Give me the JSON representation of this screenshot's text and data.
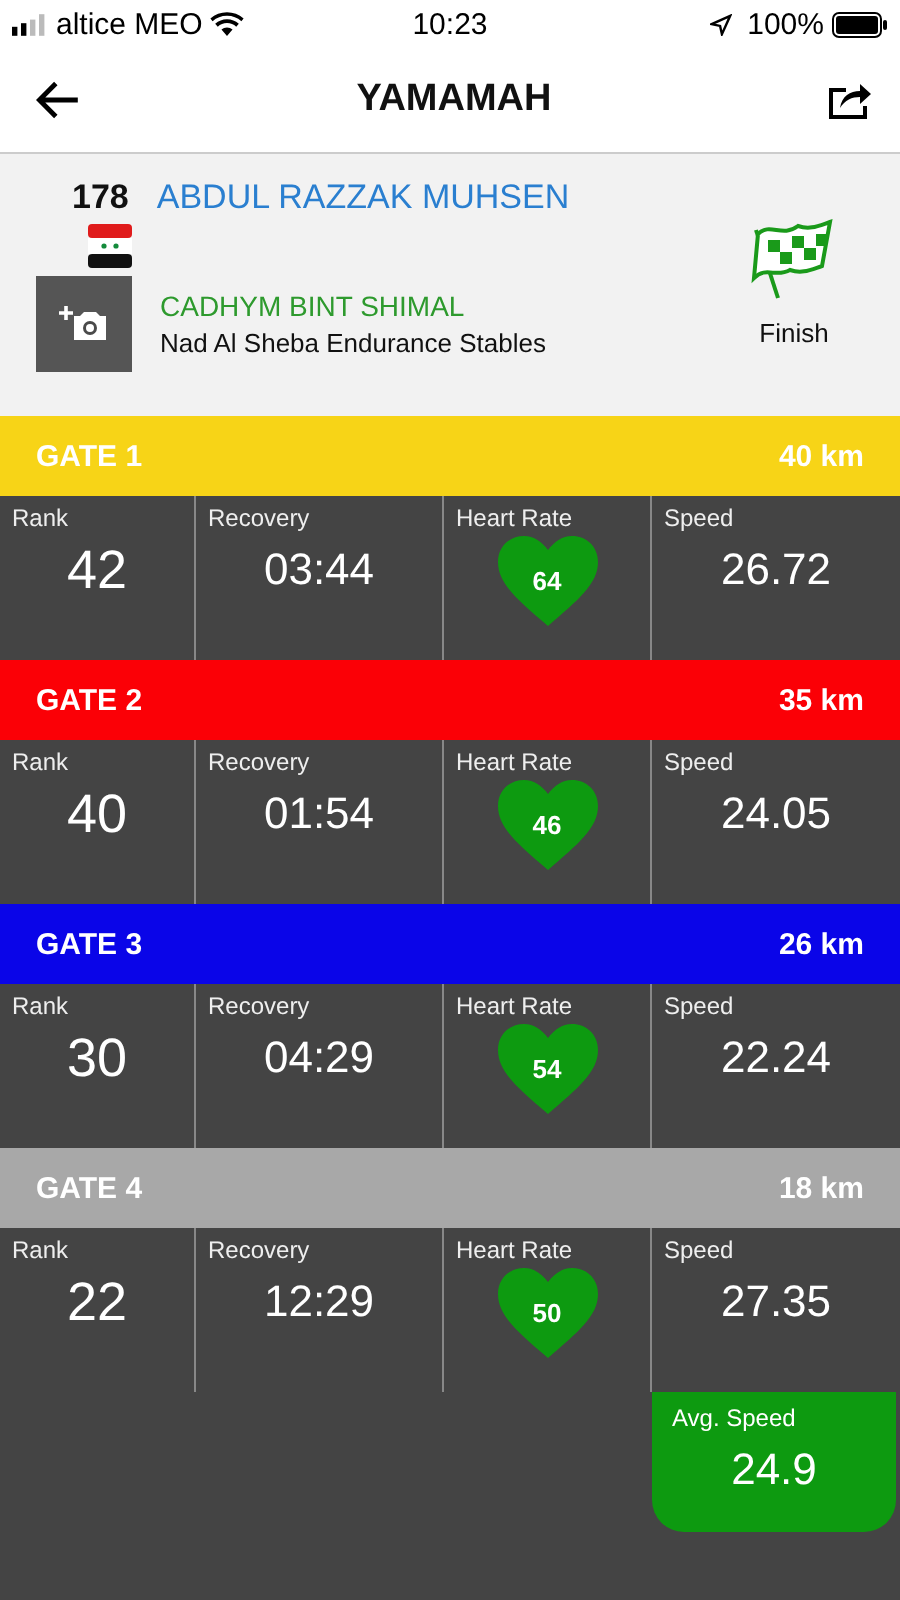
{
  "status_bar": {
    "carrier": "altice MEO",
    "time": "10:23",
    "battery": "100%"
  },
  "nav": {
    "title": "YAMAMAH"
  },
  "rider": {
    "number": "178",
    "name": "ABDUL RAZZAK MUHSEN",
    "horse": "CADHYM BINT SHIMAL",
    "stable": "Nad Al Sheba Endurance Stables",
    "status": "Finish"
  },
  "gates": [
    {
      "name": "GATE 1",
      "distance": "40 km",
      "color": "#f7d417",
      "labels": {
        "rank": "Rank",
        "recovery": "Recovery",
        "heart_rate": "Heart Rate",
        "speed": "Speed"
      },
      "rank": "42",
      "recovery": "03:44",
      "heart_rate": "64",
      "speed": "26.72"
    },
    {
      "name": "GATE 2",
      "distance": "35 km",
      "color": "#fb0006",
      "labels": {
        "rank": "Rank",
        "recovery": "Recovery",
        "heart_rate": "Heart Rate",
        "speed": "Speed"
      },
      "rank": "40",
      "recovery": "01:54",
      "heart_rate": "46",
      "speed": "24.05"
    },
    {
      "name": "GATE 3",
      "distance": "26 km",
      "color": "#0a05e8",
      "labels": {
        "rank": "Rank",
        "recovery": "Recovery",
        "heart_rate": "Heart Rate",
        "speed": "Speed"
      },
      "rank": "30",
      "recovery": "04:29",
      "heart_rate": "54",
      "speed": "22.24"
    },
    {
      "name": "GATE 4",
      "distance": "18 km",
      "color": "#a8a8a8",
      "labels": {
        "rank": "Rank",
        "recovery": "Recovery",
        "heart_rate": "Heart Rate",
        "speed": "Speed"
      },
      "rank": "22",
      "recovery": "12:29",
      "heart_rate": "50",
      "speed": "27.35"
    }
  ],
  "average": {
    "label": "Avg. Speed",
    "value": "24.9"
  }
}
